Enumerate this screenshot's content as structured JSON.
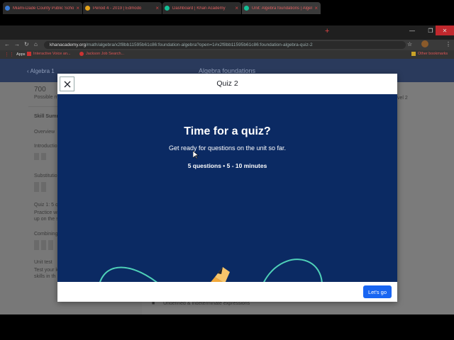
{
  "browser": {
    "tabs": [
      {
        "title": "Miami-Dade County Public Scho",
        "favicon_color": "#3a7bd5",
        "active": false
      },
      {
        "title": "Period 4 - 2019 | Edmodo",
        "favicon_color": "#e3a21a",
        "active": false
      },
      {
        "title": "Dashboard | Khan Academy",
        "favicon_color": "#14bf96",
        "active": false
      },
      {
        "title": "Unit: Algebra foundations | Algel",
        "favicon_color": "#14bf96",
        "active": true
      }
    ],
    "close_glyph": "×",
    "new_tab_glyph": "+",
    "url_host": "khanacademy.org",
    "url_path": "/math/algebra/x2f8bb11595b61c86:foundation-algebra?open=1#x2f8bb11595b61c86:foundation-algebra-quiz-2",
    "bookmarks": [
      {
        "label": "Apps"
      },
      {
        "label": "Interactive Voice an..."
      },
      {
        "label": "Jackson Job Search..."
      }
    ],
    "other_bookmarks": "Other bookmarks"
  },
  "page": {
    "back_label": "Algebra 1",
    "header_title": "Algebra foundations",
    "points": "700",
    "points_label": "Possible m",
    "skill_summary": "Skill Summ",
    "overview": "Overview",
    "sidebar_items": [
      "Introductio",
      "Substitutio",
      "Quiz 1: 5 q",
      "Combining",
      "Unit test"
    ],
    "quiz1_desc": "Practice wi\nup on the s",
    "unit_test_desc": "Test your k\nskills in th",
    "level2": "vel 2",
    "bottom_item": "Undefined & indeterminate expressions"
  },
  "modal": {
    "title": "Quiz 2",
    "heading": "Time for a quiz?",
    "subtitle": "Get ready for questions on the unit so far.",
    "meta": "5 questions • 5 - 10 minutes",
    "action": "Let's go",
    "close_icon": "close-icon"
  },
  "colors": {
    "modal_body": "#0b2a63",
    "accent_button": "#1865f2",
    "illustration_line": "#4fd1b8",
    "pencil": "#f2a93b"
  }
}
